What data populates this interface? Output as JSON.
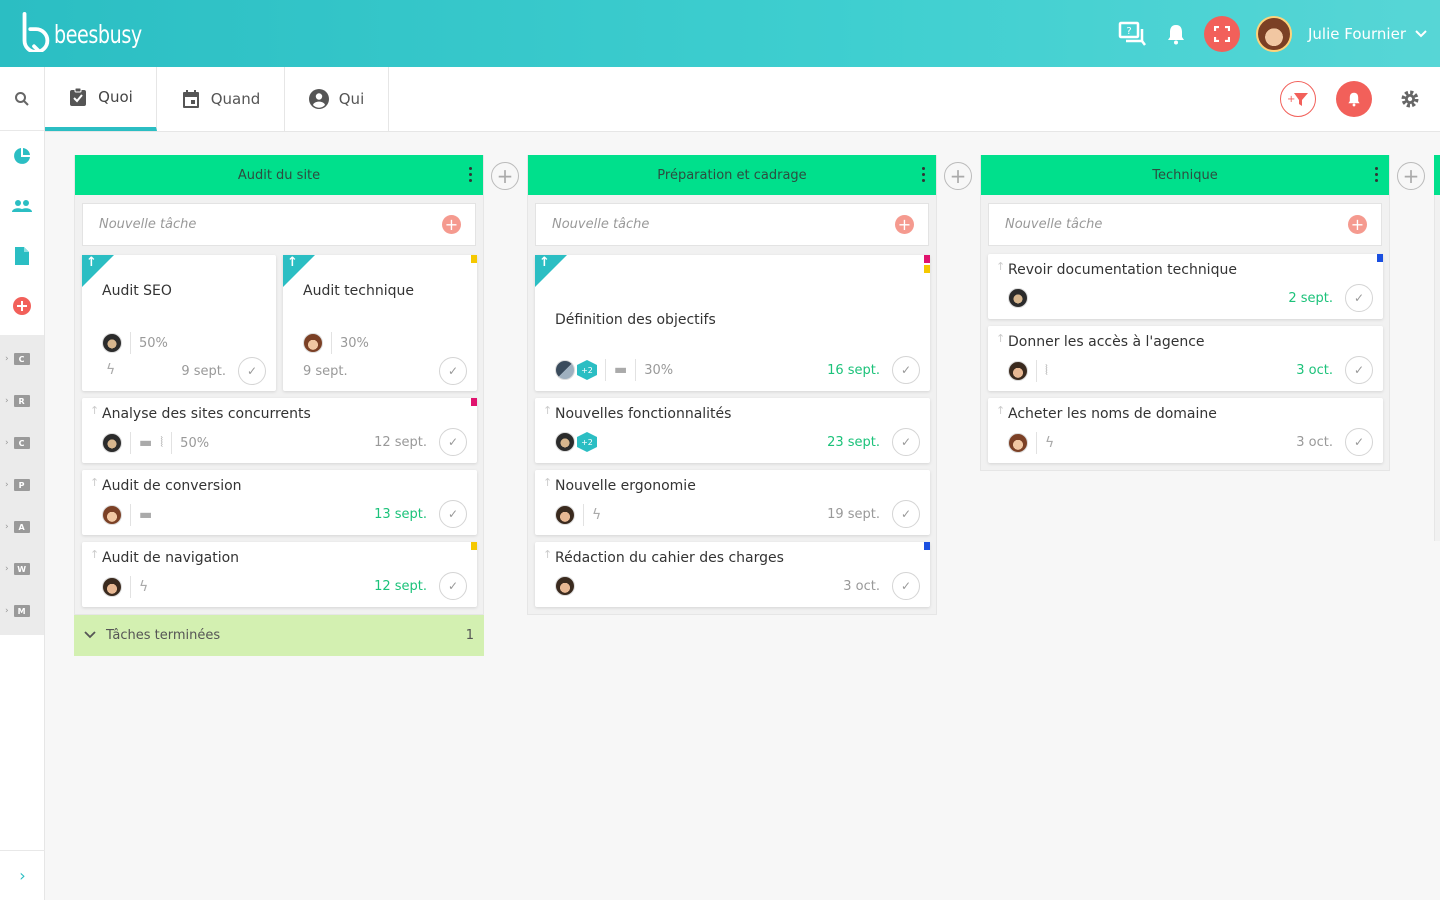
{
  "header": {
    "brand": "beesbusy",
    "username": "Julie Fournier"
  },
  "leftnav": {
    "projects": [
      "C",
      "R",
      "C",
      "P",
      "A",
      "W",
      "M"
    ],
    "expand": "›"
  },
  "tabs": [
    {
      "label": "Quoi",
      "icon": "clipboard-check-icon"
    },
    {
      "label": "Quand",
      "icon": "calendar-icon"
    },
    {
      "label": "Qui",
      "icon": "user-circle-icon"
    }
  ],
  "new_task_placeholder": "Nouvelle tâche",
  "columns": [
    {
      "title": "Audit du site"
    },
    {
      "title": "Préparation et cadrage"
    },
    {
      "title": "Technique"
    }
  ],
  "cards": {
    "c1": {
      "title": "Audit SEO",
      "percent": "50%",
      "date": "9 sept."
    },
    "c2": {
      "title": "Audit technique",
      "percent": "30%",
      "date": "9 sept."
    },
    "c3": {
      "title": "Analyse des sites concurrents",
      "percent": "50%",
      "date": "12 sept."
    },
    "c4": {
      "title": "Audit de conversion",
      "date": "13 sept."
    },
    "c5": {
      "title": "Audit de navigation",
      "date": "12 sept."
    },
    "c6": {
      "title": "Définition des objectifs",
      "extra": "+2",
      "percent": "30%",
      "date": "16 sept."
    },
    "c7": {
      "title": "Nouvelles fonctionnalités",
      "extra": "+2",
      "date": "23 sept."
    },
    "c8": {
      "title": "Nouvelle ergonomie",
      "date": "19 sept."
    },
    "c9": {
      "title": "Rédaction du cahier des charges",
      "date": "3 oct."
    },
    "c10": {
      "title": "Revoir documentation technique",
      "date": "2 sept."
    },
    "c11": {
      "title": "Donner les accès à l'agence",
      "date": "3 oct."
    },
    "c12": {
      "title": "Acheter les noms de domaine",
      "date": "3 oct."
    }
  },
  "done": {
    "label": "Tâches terminées",
    "count": "1"
  },
  "colors": {
    "accent": "#2bbec3",
    "column_header": "#00e08c",
    "danger": "#f2605a",
    "done": "#d3f0b1",
    "green_date": "#1cc27a"
  }
}
